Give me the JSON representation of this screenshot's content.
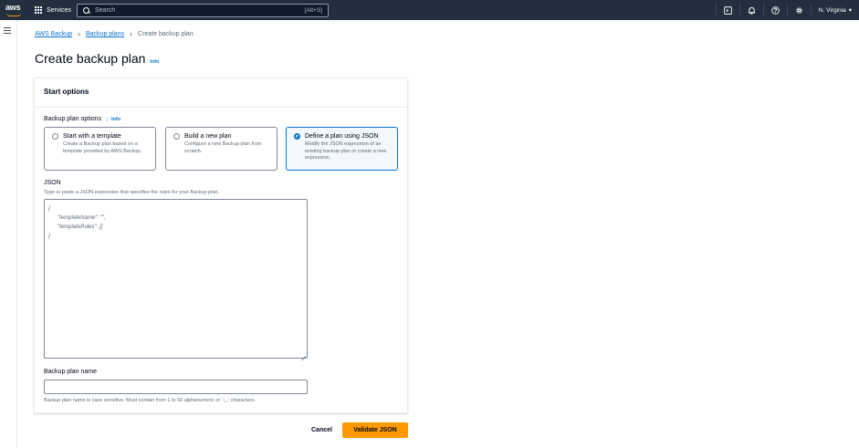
{
  "topnav": {
    "logo": "aws",
    "services_label": "Services",
    "search_placeholder": "Search",
    "search_shortcut": "[Alt+S]",
    "region": "N. Virginia"
  },
  "breadcrumb": {
    "items": [
      "AWS Backup",
      "Backup plans"
    ],
    "current": "Create backup plan"
  },
  "page": {
    "title": "Create backup plan",
    "info": "Info"
  },
  "start_options": {
    "heading": "Start options",
    "plan_options_label": "Backup plan options",
    "info": "Info",
    "tiles": [
      {
        "title": "Start with a template",
        "desc": "Create a Backup plan based on a template provided by AWS Backup.",
        "selected": false
      },
      {
        "title": "Build a new plan",
        "desc": "Configure a new Backup plan from scratch.",
        "selected": false
      },
      {
        "title": "Define a plan using JSON",
        "desc": "Modify the JSON expression of an existing backup plan or create a new expression.",
        "selected": true
      }
    ],
    "json_label": "JSON",
    "json_desc": "Type or paste a JSON expression that specifies the rules for your Backup plan.",
    "json_lines": [
      "{",
      "\"templateName\": \"\",",
      "\"templateRules\": []",
      "}"
    ],
    "name_label": "Backup plan name",
    "name_value": "",
    "name_hint": "Backup plan name is case sensitive. Must contain from 1 to 50 alphanumeric or '-_.' characters."
  },
  "actions": {
    "cancel": "Cancel",
    "validate": "Validate JSON"
  },
  "colors": {
    "nav_bg": "#232f3e",
    "link": "#0972d3",
    "primary_button": "#ff9900"
  }
}
